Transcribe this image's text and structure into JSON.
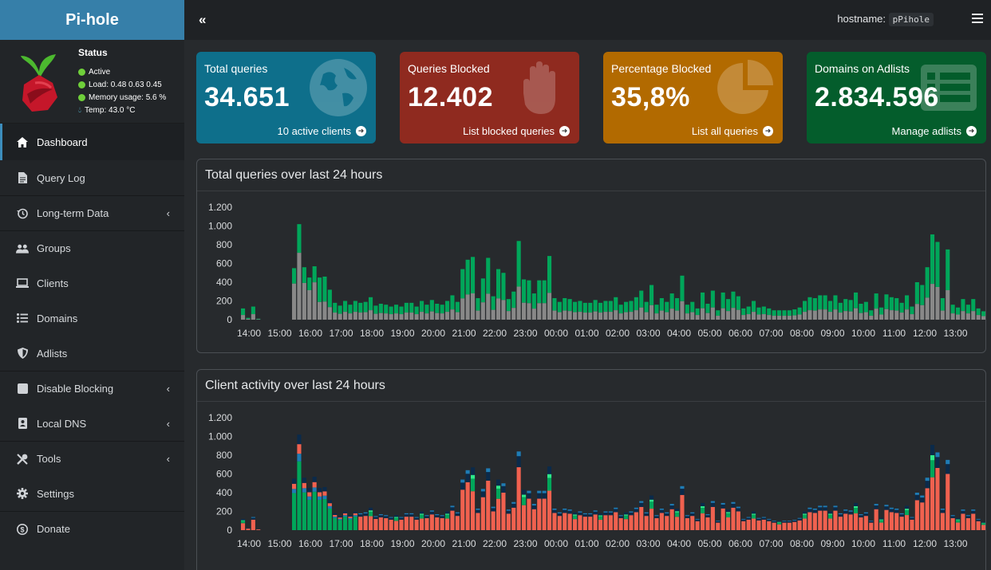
{
  "app": {
    "title": "Pi-hole"
  },
  "topbar": {
    "hostname_label": "hostname:",
    "hostname_value": "pPihole"
  },
  "status": {
    "title": "Status",
    "active": "Active",
    "load": "Load:  0.48  0.63  0.45",
    "memory": "Memory usage:  5.6 %",
    "temp": "Temp: 43.0 °C"
  },
  "menu": [
    {
      "label": "Dashboard",
      "icon": "home-icon",
      "active": true
    },
    {
      "label": "Query Log",
      "icon": "file-icon"
    },
    {
      "label": "Long-term Data",
      "icon": "history-icon",
      "expandable": true
    },
    {
      "label": "Groups",
      "icon": "users-icon"
    },
    {
      "label": "Clients",
      "icon": "laptop-icon"
    },
    {
      "label": "Domains",
      "icon": "list-icon"
    },
    {
      "label": "Adlists",
      "icon": "shield-icon"
    },
    {
      "label": "Disable Blocking",
      "icon": "stop-icon",
      "expandable": true
    },
    {
      "label": "Local DNS",
      "icon": "address-book-icon",
      "expandable": true
    },
    {
      "label": "Tools",
      "icon": "tools-icon",
      "expandable": true
    },
    {
      "label": "Settings",
      "icon": "gear-icon"
    },
    {
      "label": "Donate",
      "icon": "donate-icon"
    }
  ],
  "stats": [
    {
      "label": "Total queries",
      "value": "34.651",
      "footer": "10 active clients",
      "color": "#0e6f8b",
      "icon": "globe-icon"
    },
    {
      "label": "Queries Blocked",
      "value": "12.402",
      "footer": "List blocked queries",
      "color": "#8f2a1f",
      "icon": "hand-icon"
    },
    {
      "label": "Percentage Blocked",
      "value": "35,8%",
      "footer": "List all queries",
      "color": "#b26a00",
      "icon": "pie-chart-icon"
    },
    {
      "label": "Domains on Adlists",
      "value": "2.834.596",
      "footer": "Manage adlists",
      "color": "#045d2c",
      "icon": "list-alt-icon"
    }
  ],
  "charts": {
    "queries_title": "Total queries over last 24 hours",
    "clients_title": "Client activity over last 24 hours"
  },
  "chart_data": [
    {
      "type": "bar",
      "title": "Total queries over last 24 hours",
      "stacked": true,
      "ylim": [
        0,
        1200
      ],
      "yticks": [
        "0",
        "200",
        "400",
        "600",
        "800",
        "1.000",
        "1.200"
      ],
      "xtick_labels": [
        "14:00",
        "15:00",
        "16:00",
        "17:00",
        "18:00",
        "19:00",
        "20:00",
        "21:00",
        "22:00",
        "23:00",
        "00:00",
        "01:00",
        "02:00",
        "03:00",
        "04:00",
        "05:00",
        "06:00",
        "07:00",
        "08:00",
        "09:00",
        "10:00",
        "11:00",
        "12:00",
        "13:00"
      ],
      "colors": {
        "blocked": "#888888",
        "permitted": "#00a65a"
      },
      "series": [
        {
          "values_total": [
            120,
            20,
            140,
            10,
            0,
            0,
            0,
            0,
            0,
            0,
            550,
            1020,
            560,
            450,
            570,
            450,
            460,
            320,
            180,
            150,
            200,
            160,
            200,
            180,
            190,
            240,
            150,
            170,
            160,
            140,
            160,
            140,
            180,
            180,
            140,
            200,
            160,
            210,
            170,
            160,
            200,
            260,
            190,
            540,
            640,
            670,
            230,
            440,
            660,
            250,
            540,
            500,
            220,
            300,
            840,
            430,
            420,
            280,
            420,
            420,
            680,
            230,
            190,
            230,
            220,
            190,
            200,
            180,
            180,
            210,
            180,
            200,
            200,
            240,
            160,
            190,
            200,
            240,
            310,
            190,
            370,
            160,
            230,
            190,
            280,
            230,
            470,
            160,
            190,
            120,
            290,
            170,
            310,
            100,
            290,
            220,
            300,
            250,
            120,
            140,
            200,
            130,
            140,
            120,
            100,
            100,
            100,
            100,
            110,
            130,
            200,
            240,
            230,
            260,
            260,
            200,
            260,
            180,
            220,
            210,
            290,
            170,
            190,
            100,
            280,
            130,
            270,
            240,
            230,
            180,
            260,
            140,
            400,
            370,
            560,
            910,
            830,
            230,
            750,
            160,
            130,
            220,
            160,
            220,
            120,
            90,
            50
          ]
        }
      ]
    },
    {
      "type": "bar",
      "title": "Client activity over last 24 hours",
      "stacked": true,
      "ylim": [
        0,
        1200
      ],
      "yticks": [
        "0",
        "200",
        "400",
        "600",
        "800",
        "1.000",
        "1.200"
      ],
      "xtick_labels": [
        "14:00",
        "15:00",
        "16:00",
        "17:00",
        "18:00",
        "19:00",
        "20:00",
        "21:00",
        "22:00",
        "23:00",
        "00:00",
        "01:00",
        "02:00",
        "03:00",
        "04:00",
        "05:00",
        "06:00",
        "07:00",
        "08:00",
        "09:00",
        "10:00",
        "11:00",
        "12:00",
        "13:00"
      ],
      "colors": {
        "client_a": "#f0614f",
        "client_b": "#00a65a",
        "client_c": "#1e7cb5",
        "client_d": "#0b2a4a",
        "client_e": "#2ee88a"
      }
    }
  ]
}
